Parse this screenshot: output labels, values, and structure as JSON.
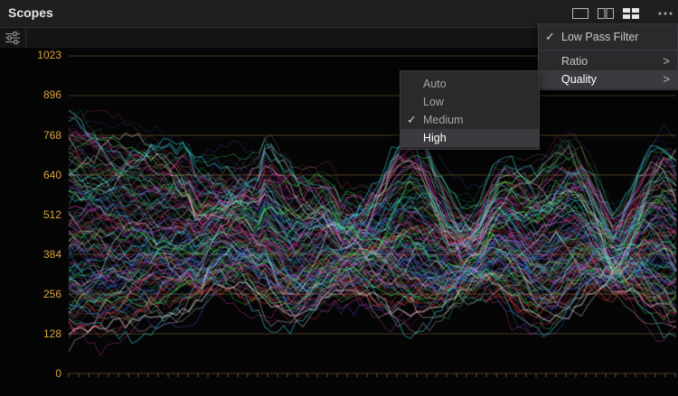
{
  "window": {
    "title": "Scopes"
  },
  "view_modes": [
    {
      "name": "single-view",
      "icon": "single-pane-icon",
      "active": false
    },
    {
      "name": "dual-view",
      "icon": "dual-pane-icon",
      "active": false
    },
    {
      "name": "quad-view",
      "icon": "quad-pane-icon",
      "active": true
    }
  ],
  "more_icon": "ellipsis-icon",
  "settings_icon": "sliders-icon",
  "scope": {
    "y_ticks": [
      "1023",
      "896",
      "768",
      "640",
      "512",
      "384",
      "256",
      "128",
      "0"
    ],
    "tick_color": "#d9a441"
  },
  "options_menu": {
    "items": [
      {
        "label": "Low Pass Filter",
        "checked": true
      },
      {
        "label": "Ratio",
        "submenu": true
      },
      {
        "label": "Quality",
        "submenu": true,
        "active": true
      }
    ]
  },
  "quality_menu": {
    "items": [
      {
        "label": "Auto",
        "checked": false
      },
      {
        "label": "Low",
        "checked": false
      },
      {
        "label": "Medium",
        "checked": true
      },
      {
        "label": "High",
        "checked": false,
        "hovered": true
      }
    ]
  }
}
